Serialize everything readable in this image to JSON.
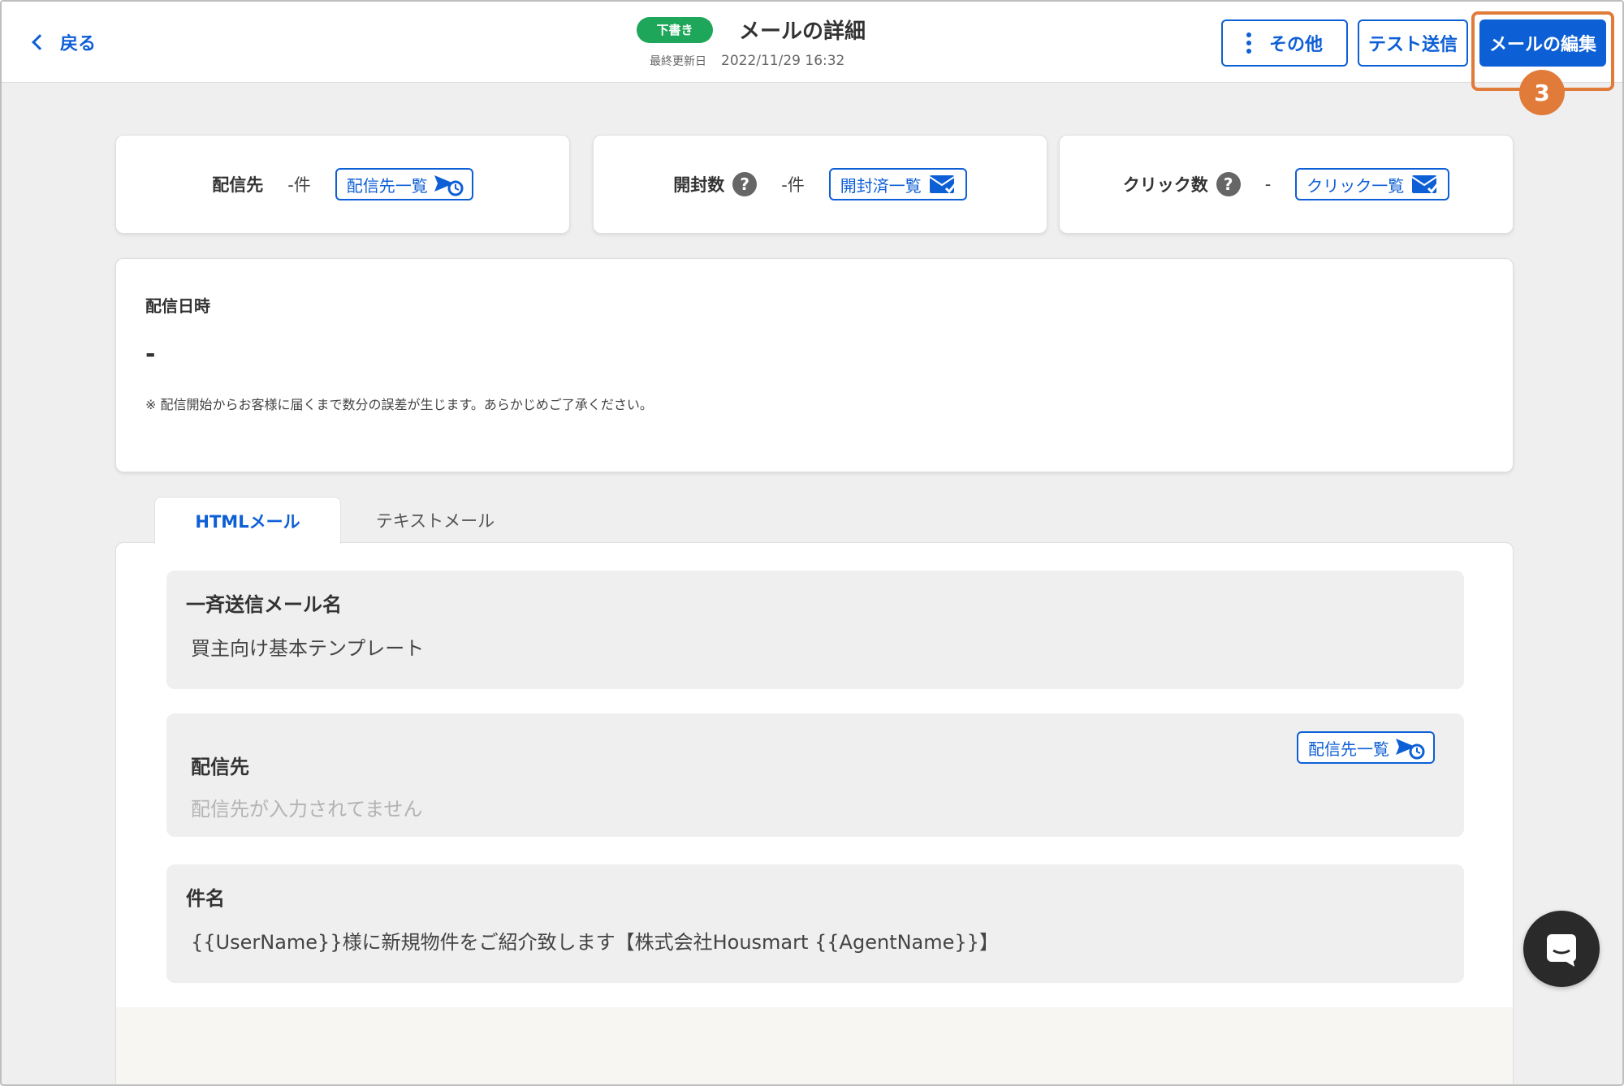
{
  "header": {
    "back_label": "戻る",
    "status_badge": "下書き",
    "title": "メールの詳細",
    "updated_label": "最終更新日",
    "updated_value": "2022/11/29 16:32",
    "more_label": "その他",
    "test_send_label": "テスト送信",
    "edit_label": "メールの編集",
    "step_number": "3"
  },
  "stats": {
    "recipients": {
      "label": "配信先",
      "value": "-件",
      "button_label": "配信先一覧"
    },
    "opens": {
      "label": "開封数",
      "help": "?",
      "value": "-件",
      "button_label": "開封済一覧"
    },
    "clicks": {
      "label": "クリック数",
      "help": "?",
      "value": "-",
      "button_label": "クリック一覧"
    }
  },
  "schedule": {
    "label": "配信日時",
    "value": "-",
    "note": "※ 配信開始からお客様に届くまで数分の誤差が生じます。あらかじめご了承ください。"
  },
  "tabs": [
    {
      "label": "HTMLメール",
      "active": true
    },
    {
      "label": "テキストメール",
      "active": false
    }
  ],
  "details": {
    "mail_name_label": "一斉送信メール名",
    "mail_name_value": "買主向け基本テンプレート",
    "recipients_label": "配信先",
    "recipients_placeholder": "配信先が入力されてません",
    "recipients_button_label": "配信先一覧",
    "subject_label": "件名",
    "subject_value": "{{UserName}}様に新規物件をご紹介致します【株式会社Housmart {{AgentName}}】"
  },
  "colors": {
    "accent": "#0d5fd6",
    "draft_badge": "#1ea75a",
    "highlight": "#e07b39"
  }
}
